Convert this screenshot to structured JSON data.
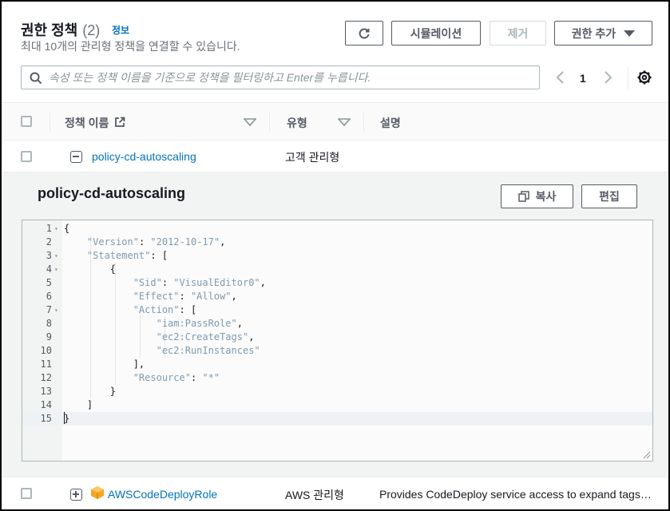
{
  "header": {
    "title": "권한 정책",
    "count": "(2)",
    "info_link": "정보",
    "description": "최대 10개의 관리형 정책을 연결할 수 있습니다."
  },
  "toolbar": {
    "refresh_icon": "refresh-icon",
    "simulation_label": "시뮬레이션",
    "remove_label": "제거",
    "add_label": "권한 추가"
  },
  "search": {
    "placeholder": "속성 또는 정책 이름을 기준으로 정책을 필터링하고 Enter를 누릅니다."
  },
  "pagination": {
    "current_page": "1"
  },
  "table": {
    "columns": [
      "정책 이름",
      "유형",
      "설명"
    ],
    "rows": [
      {
        "name": "policy-cd-autoscaling",
        "type": "고객 관리형",
        "description": "",
        "expanded": true
      },
      {
        "name": "AWSCodeDeployRole",
        "type": "AWS 관리형",
        "description": "Provides CodeDeploy service access to expand tags…",
        "expanded": false
      }
    ]
  },
  "detail": {
    "title": "policy-cd-autoscaling",
    "copy_label": "복사",
    "edit_label": "편집",
    "code_lines": [
      {
        "n": "1",
        "text": "{"
      },
      {
        "n": "2",
        "text": "    \"Version\": \"2012-10-17\","
      },
      {
        "n": "3",
        "text": "    \"Statement\": ["
      },
      {
        "n": "4",
        "text": "        {"
      },
      {
        "n": "5",
        "text": "            \"Sid\": \"VisualEditor0\","
      },
      {
        "n": "6",
        "text": "            \"Effect\": \"Allow\","
      },
      {
        "n": "7",
        "text": "            \"Action\": ["
      },
      {
        "n": "8",
        "text": "                \"iam:PassRole\","
      },
      {
        "n": "9",
        "text": "                \"ec2:CreateTags\","
      },
      {
        "n": "10",
        "text": "                \"ec2:RunInstances\""
      },
      {
        "n": "11",
        "text": "            ],"
      },
      {
        "n": "12",
        "text": "            \"Resource\": \"*\""
      },
      {
        "n": "13",
        "text": "        }"
      },
      {
        "n": "14",
        "text": "    ]"
      },
      {
        "n": "15",
        "text": "}"
      }
    ]
  },
  "colors": {
    "link": "#0073bb",
    "border": "#aab7b8",
    "button_text": "#545b64",
    "aws_icon": "#f7a521"
  }
}
